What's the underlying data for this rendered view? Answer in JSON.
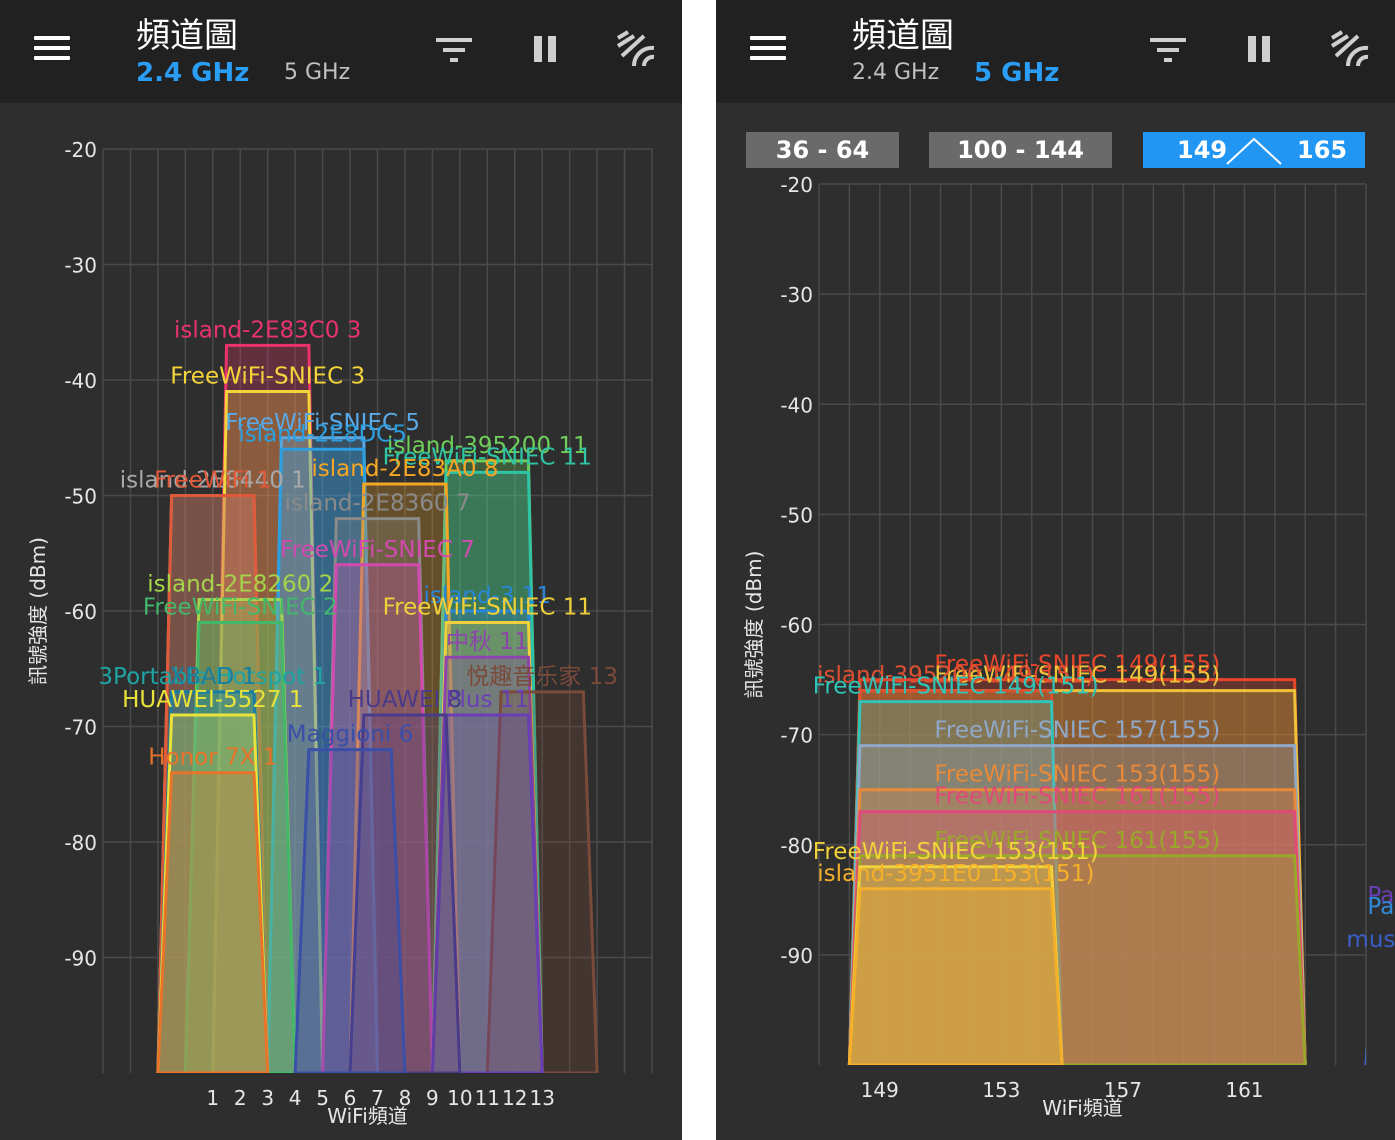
{
  "left": {
    "title": "頻道圖",
    "tabs": [
      {
        "label": "2.4 GHz",
        "active": true
      },
      {
        "label": "5 GHz",
        "active": false
      }
    ],
    "icons": [
      "menu-icon",
      "filter-icon",
      "pause-icon",
      "wifi-scan-icon"
    ],
    "chart_data": {
      "type": "area",
      "xlabel": "WiFi頻道",
      "ylabel": "訊號強度 (dBm)",
      "ylim": [
        -100,
        -20
      ],
      "yticks": [
        -20,
        -30,
        -40,
        -50,
        -60,
        -70,
        -80,
        -90
      ],
      "x_ticks": [
        "1",
        "2",
        "3",
        "4",
        "5",
        "6",
        "7",
        "8",
        "9",
        "10",
        "11",
        "12",
        "13"
      ],
      "channel_range": [
        -3,
        17
      ],
      "networks": [
        {
          "name": "island-2E83C0 3",
          "channel": 3,
          "dbm": -37,
          "color": "#e8336d"
        },
        {
          "name": "FreeWiFi-SNIEC 3",
          "channel": 3,
          "dbm": -41,
          "color": "#f5d33a"
        },
        {
          "name": "FreeWiFi-SNIEC 5",
          "channel": 5,
          "dbm": -45,
          "color": "#5aa9e6"
        },
        {
          "name": "island-2E8DC5",
          "channel": 5,
          "dbm": -46,
          "color": "#2b9fe0"
        },
        {
          "name": "island-2E8440 1",
          "channel": 1,
          "dbm": -50,
          "color": "#a8a8a8"
        },
        {
          "name": "FreeWiFi 1",
          "channel": 1,
          "dbm": -50,
          "color": "#e05a3a"
        },
        {
          "name": "island-395200 11",
          "channel": 11,
          "dbm": -47,
          "color": "#6fcf5a"
        },
        {
          "name": "FreeWiFi-SNIEC 11",
          "channel": 11,
          "dbm": -48,
          "color": "#2ec4a5"
        },
        {
          "name": "island-2E83A0 8",
          "channel": 8,
          "dbm": -49,
          "color": "#f5a623"
        },
        {
          "name": "island-2E8360 7",
          "channel": 7,
          "dbm": -52,
          "color": "#8a8a8a"
        },
        {
          "name": "FreeWiFi-SNIEC 7",
          "channel": 7,
          "dbm": -56,
          "color": "#d14ab0"
        },
        {
          "name": "island-2E8260 2",
          "channel": 2,
          "dbm": -59,
          "color": "#a6d44a"
        },
        {
          "name": "FreeWiFi-SNIEC 2",
          "channel": 2,
          "dbm": -61,
          "color": "#43b86a"
        },
        {
          "name": "island-3 11",
          "channel": 11,
          "dbm": -60,
          "color": "#2a86d8"
        },
        {
          "name": "FreeWiFi-SNIEC 11",
          "channel": 11,
          "dbm": -61,
          "color": "#f0d03a"
        },
        {
          "name": "中秋 11",
          "channel": 11,
          "dbm": -64,
          "color": "#8e44ad"
        },
        {
          "name": "悦趣音乐家 13",
          "channel": 13,
          "dbm": -67,
          "color": "#7a4a3a"
        },
        {
          "name": "Plus 11",
          "channel": 11,
          "dbm": -69,
          "color": "#6a3fb5"
        },
        {
          "name": "HUAWEI 8",
          "channel": 8,
          "dbm": -69,
          "color": "#4a3a8a"
        },
        {
          "name": "3Portable Hotspot 1",
          "channel": 1,
          "dbm": -67,
          "color": "#1fa3a3"
        },
        {
          "name": "XBAD 1",
          "channel": 1,
          "dbm": -67,
          "color": "#1a7ea0"
        },
        {
          "name": "HUAWEI-5527 1",
          "channel": 1,
          "dbm": -69,
          "color": "#e8e23a"
        },
        {
          "name": "Maggioni 6",
          "channel": 6,
          "dbm": -72,
          "color": "#3a4fa8"
        },
        {
          "name": "Honor 7X 1",
          "channel": 1,
          "dbm": -74,
          "color": "#e8742a"
        }
      ]
    }
  },
  "right": {
    "title": "頻道圖",
    "tabs": [
      {
        "label": "2.4 GHz",
        "active": false
      },
      {
        "label": "5 GHz",
        "active": true
      }
    ],
    "bands": [
      {
        "label": "36 - 64",
        "active": false
      },
      {
        "label": "100 - 144",
        "active": false
      },
      {
        "label_a": "149",
        "label_b": "165",
        "active": true
      }
    ],
    "chart_data": {
      "type": "area",
      "xlabel": "WiFi頻道",
      "ylabel": "訊號強度 (dBm)",
      "ylim": [
        -100,
        -20
      ],
      "yticks": [
        -20,
        -30,
        -40,
        -50,
        -60,
        -70,
        -80,
        -90
      ],
      "x_ticks": [
        "149",
        "153",
        "157",
        "161"
      ],
      "channel_range": [
        147,
        165
      ],
      "networks": [
        {
          "name": "FreeWiFi-SNIEC 149(155)",
          "lo": 148,
          "hi": 163,
          "dbm": -65,
          "color": "#e8462a"
        },
        {
          "name": "FreeWiFi-SNIEC 149(155)",
          "lo": 148,
          "hi": 163,
          "dbm": -66,
          "color": "#f0c23a"
        },
        {
          "name": "island-395200 149(151)",
          "lo": 148,
          "hi": 155,
          "dbm": -66,
          "color": "#e05030"
        },
        {
          "name": "FreeWiFi-SNIEC 149(151)",
          "lo": 148,
          "hi": 155,
          "dbm": -67,
          "color": "#2ec4b8"
        },
        {
          "name": "FreeWiFi-SNIEC 157(155)",
          "lo": 148,
          "hi": 163,
          "dbm": -71,
          "color": "#8fa8c8"
        },
        {
          "name": "FreeWiFi-SNIEC 153(155)",
          "lo": 148,
          "hi": 163,
          "dbm": -75,
          "color": "#e88a3a"
        },
        {
          "name": "FreeWiFi-SNIEC 161(155)",
          "lo": 148,
          "hi": 163,
          "dbm": -77,
          "color": "#e04a7a"
        },
        {
          "name": "FreeWiFi-SNIEC 161(155)",
          "lo": 148,
          "hi": 163,
          "dbm": -81,
          "color": "#9aa82a"
        },
        {
          "name": "FreeWiFi-SNIEC 153(151)",
          "lo": 148,
          "hi": 155,
          "dbm": -82,
          "color": "#f0d23a"
        },
        {
          "name": "island-3951E0 153(151)",
          "lo": 148,
          "hi": 155,
          "dbm": -84,
          "color": "#f5b02a"
        },
        {
          "name": "Pavilion",
          "lo": 165,
          "hi": 168,
          "dbm": -86,
          "color": "#6a3fb5"
        },
        {
          "name": "Pavilion",
          "lo": 165,
          "hi": 168,
          "dbm": -87,
          "color": "#2e8ad8"
        },
        {
          "name": "musicchina",
          "lo": 165,
          "hi": 168,
          "dbm": -90,
          "color": "#3a5fc8"
        }
      ]
    }
  }
}
